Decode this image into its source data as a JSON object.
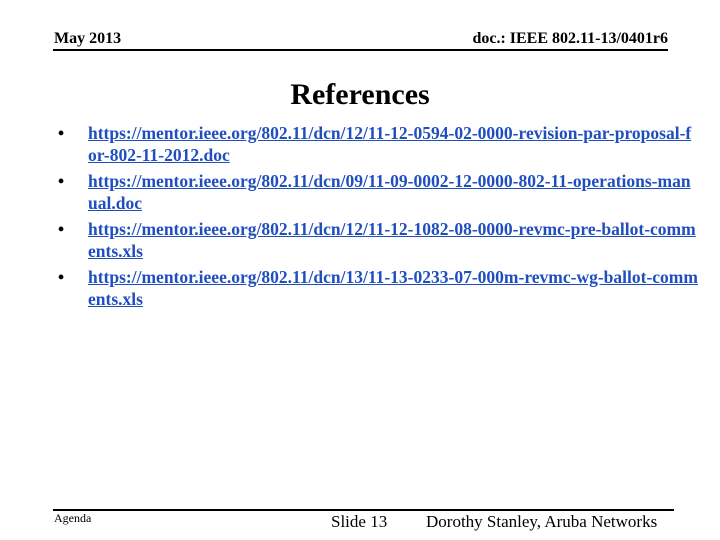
{
  "header": {
    "date": "May 2013",
    "doc_id": "doc.: IEEE 802.11-13/0401r6"
  },
  "title": "References",
  "references": [
    {
      "bullet": "•",
      "url": "https://mentor.ieee.org/802.11/dcn/12/11-12-0594-02-0000-revision-par-proposal-for-802-11-2012.doc"
    },
    {
      "bullet": "•",
      "url": "https://mentor.ieee.org/802.11/dcn/09/11-09-0002-12-0000-802-11-operations-manual.doc"
    },
    {
      "bullet": "•",
      "url": "https://mentor.ieee.org/802.11/dcn/12/11-12-1082-08-0000-revmc-pre-ballot-comments.xls"
    },
    {
      "bullet": "•",
      "url": "https://mentor.ieee.org/802.11/dcn/13/11-13-0233-07-000m-revmc-wg-ballot-comments.xls"
    }
  ],
  "footer": {
    "section": "Agenda",
    "slide": "Slide 13",
    "author": "Dorothy Stanley, Aruba Networks"
  },
  "colors": {
    "link": "#1f4fbf"
  }
}
